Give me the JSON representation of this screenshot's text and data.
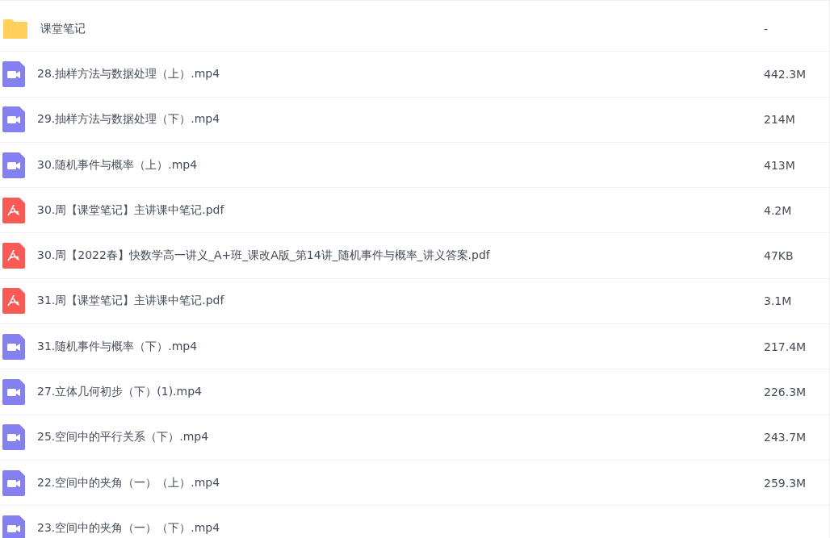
{
  "files": [
    {
      "kind": "folder",
      "name": "课堂笔记",
      "size": "-"
    },
    {
      "kind": "video",
      "name": "28.抽样方法与数据处理（上）.mp4",
      "size": "442.3M"
    },
    {
      "kind": "video",
      "name": "29.抽样方法与数据处理（下）.mp4",
      "size": "214M"
    },
    {
      "kind": "video",
      "name": "30.随机事件与概率（上）.mp4",
      "size": "413M"
    },
    {
      "kind": "pdf",
      "name": "30.周【课堂笔记】主讲课中笔记.pdf",
      "size": "4.2M"
    },
    {
      "kind": "pdf",
      "name": "30.周【2022春】快数学高一讲义_A+班_课改A版_第14讲_随机事件与概率_讲义答案.pdf",
      "size": "47KB"
    },
    {
      "kind": "pdf",
      "name": "31.周【课堂笔记】主讲课中笔记.pdf",
      "size": "3.1M"
    },
    {
      "kind": "video",
      "name": "31.随机事件与概率（下）.mp4",
      "size": "217.4M"
    },
    {
      "kind": "video",
      "name": "27.立体几何初步（下）(1).mp4",
      "size": "226.3M"
    },
    {
      "kind": "video",
      "name": "25.空间中的平行关系（下）.mp4",
      "size": "243.7M"
    },
    {
      "kind": "video",
      "name": "22.空间中的夹角（一）（上）.mp4",
      "size": "259.3M"
    },
    {
      "kind": "video",
      "name": "23.空间中的夹角（一）（下）.mp4"
    }
  ]
}
